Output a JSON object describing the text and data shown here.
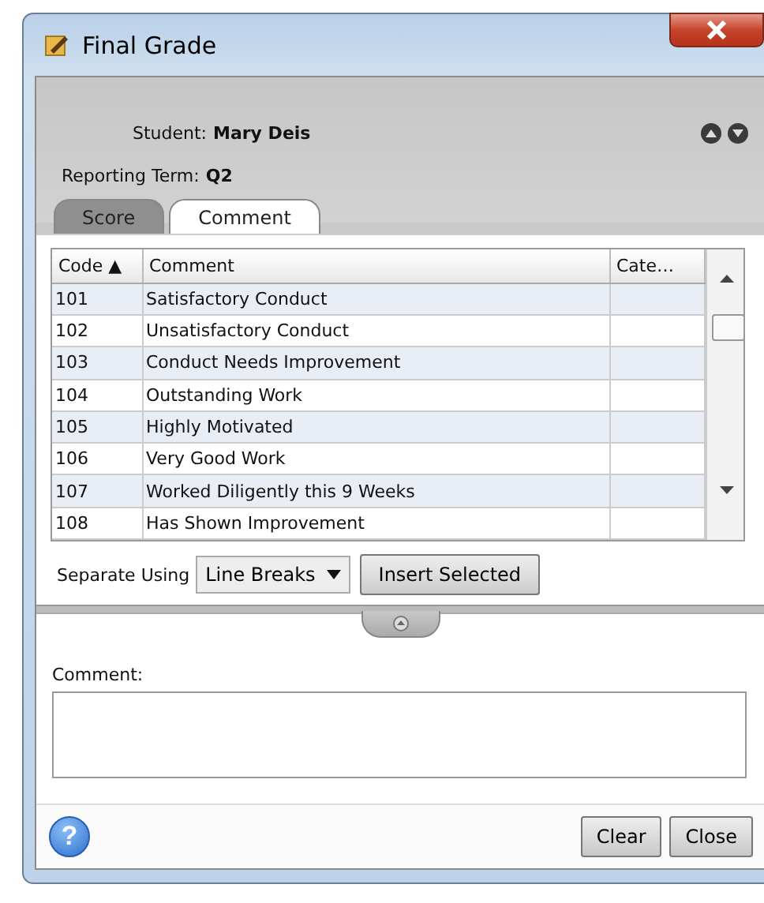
{
  "window": {
    "title": "Final Grade"
  },
  "header": {
    "student_label": "Student:",
    "student": "Mary Deis",
    "term_label": "Reporting Term:",
    "term": "Q2"
  },
  "tabs": [
    {
      "label": "Score",
      "selected": false
    },
    {
      "label": "Comment",
      "selected": true
    }
  ],
  "table": {
    "columns": [
      "Code ▲",
      "Comment",
      "Cate…"
    ],
    "rows": [
      [
        "101",
        "Satisfactory Conduct",
        ""
      ],
      [
        "102",
        "Unsatisfactory Conduct",
        ""
      ],
      [
        "103",
        "Conduct Needs Improvement",
        ""
      ],
      [
        "104",
        "Outstanding Work",
        ""
      ],
      [
        "105",
        "Highly Motivated",
        ""
      ],
      [
        "106",
        "Very Good Work",
        ""
      ],
      [
        "107",
        "Worked Diligently this 9 Weeks",
        ""
      ],
      [
        "108",
        "Has Shown Improvement",
        ""
      ]
    ]
  },
  "separate": {
    "label": "Separate Using",
    "value": "Line Breaks"
  },
  "insert_button": "Insert Selected",
  "comment": {
    "label": "Comment:"
  },
  "help": "?",
  "buttons": [
    "Clear",
    "Close"
  ]
}
